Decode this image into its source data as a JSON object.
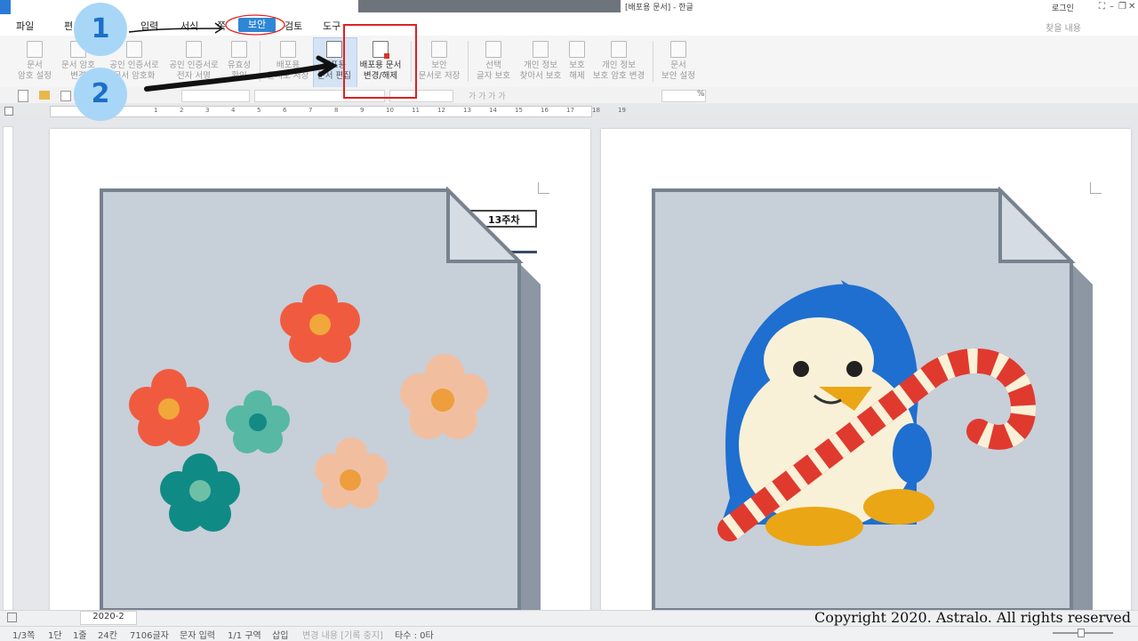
{
  "window": {
    "title": "[배포용 문서] - 한글",
    "login": "로그인",
    "controls": [
      "⛶",
      "–",
      "❐",
      "✕"
    ]
  },
  "menu": {
    "items": [
      "파일",
      "편",
      "입력",
      "서식",
      "쪽",
      "보안",
      "검토",
      "도구"
    ],
    "search_label": "찾을 내용"
  },
  "ribbon": {
    "buttons": [
      {
        "line1": "문서",
        "line2": "암호 설정"
      },
      {
        "line1": "문서 암호",
        "line2": "변경"
      },
      {
        "line1": "공인 인증서로",
        "line2": "문서 암호화"
      },
      {
        "line1": "공인 인증서로",
        "line2": "전자 서명"
      },
      {
        "line1": "유효성",
        "line2": "확인"
      },
      {
        "line1": "배포용",
        "line2": "문서로 저장"
      },
      {
        "line1": "배포용",
        "line2": "문서 편집"
      },
      {
        "line1": "배포용 문서",
        "line2": "변경/해제"
      },
      {
        "line1": "보안",
        "line2": "문서로 저장"
      },
      {
        "line1": "선택",
        "line2": "글자 보호"
      },
      {
        "line1": "개인 정보",
        "line2": "찾아서 보호"
      },
      {
        "line1": "보호",
        "line2": "해제"
      },
      {
        "line1": "개인 정보",
        "line2": "보호 암호 변경"
      },
      {
        "line1": "문서",
        "line2": "보안 설정"
      }
    ]
  },
  "toolbar": {
    "zoom_unit": "%",
    "format_buttons": "가 가 가 가"
  },
  "ruler": {
    "ticks": [
      "1",
      "2",
      "3",
      "4",
      "5",
      "6",
      "7",
      "8",
      "9",
      "10",
      "11",
      "12",
      "13",
      "14",
      "15",
      "16",
      "17",
      "18",
      "19"
    ]
  },
  "document": {
    "header_cell": "13주차"
  },
  "annotations": {
    "step1": "1",
    "step2": "2"
  },
  "tabs": {
    "doc_tab": "2020-2"
  },
  "status": {
    "page": "1/3쪽",
    "column": "1단",
    "line": "1줄",
    "char": "24칸",
    "chars_total": "7106글자",
    "mode": "문자 입력",
    "section": "1/1 구역",
    "insert": "삽입",
    "track": "변경 내용 [기록 중지]",
    "typing": "타수 : 0타"
  },
  "copyright": "Copyright 2020. Astralo. All rights reserved",
  "colors": {
    "accent": "#2e86d4",
    "highlight_box": "#e02020",
    "doc_icon_fill": "#c7cfd9",
    "doc_icon_stroke": "#77828f",
    "penguin_blue": "#1e6fd0",
    "candy_red": "#e03a2f"
  }
}
